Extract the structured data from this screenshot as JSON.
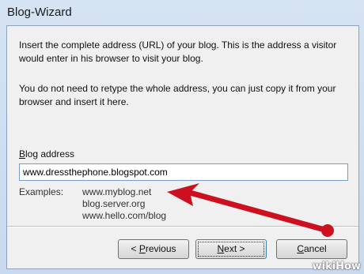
{
  "window": {
    "title": "Blog-Wizard"
  },
  "instructions": {
    "paragraph1": "Insert the complete address (URL) of your blog. This is the address a visitor would enter in his browser to visit your blog.",
    "paragraph2": "You do not need to retype the whole address, you can just copy it from your browser and insert it here."
  },
  "field": {
    "label_accel": "B",
    "label_rest": "log address",
    "value": "www.dressthephone.blogspot.com"
  },
  "examples": {
    "label": "Examples:",
    "items": [
      "www.myblog.net",
      "blog.server.org",
      "www.hello.com/blog"
    ]
  },
  "buttons": {
    "previous_prefix": "< ",
    "previous_accel": "P",
    "previous_rest": "revious",
    "next_accel": "N",
    "next_rest": "ext >",
    "cancel_accel": "C",
    "cancel_rest": "ancel"
  },
  "annotation": {
    "arrow_color": "#cc1020"
  },
  "watermark": {
    "text": "wikiHow"
  }
}
